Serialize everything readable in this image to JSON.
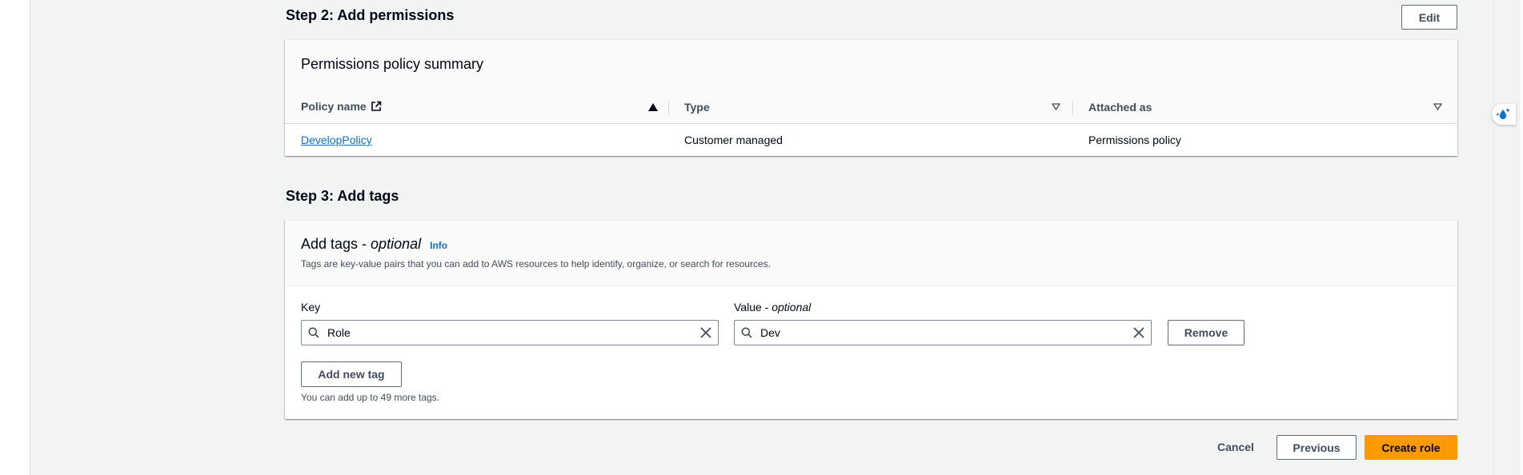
{
  "step2": {
    "title": "Step 2: Add permissions",
    "edit_label": "Edit",
    "summary_title": "Permissions policy summary",
    "columns": [
      "Policy name",
      "Type",
      "Attached as"
    ],
    "rows": [
      {
        "name": "DevelopPolicy",
        "type": "Customer managed",
        "attached": "Permissions policy"
      }
    ]
  },
  "step3": {
    "title": "Step 3: Add tags",
    "tags_title": "Add tags - ",
    "tags_title_optional": "optional",
    "info_label": "Info",
    "description": "Tags are key-value pairs that you can add to AWS resources to help identify, organize, or search for resources.",
    "key_label": "Key",
    "value_label": "Value - ",
    "value_label_optional": "optional",
    "key_value": "Role",
    "value_value": "Dev",
    "remove_label": "Remove",
    "add_tag_label": "Add new tag",
    "limit_text": "You can add up to 49 more tags."
  },
  "footer": {
    "cancel_label": "Cancel",
    "previous_label": "Previous",
    "create_label": "Create role"
  },
  "colors": {
    "primary": "#ff9900",
    "link": "#0972d3"
  }
}
